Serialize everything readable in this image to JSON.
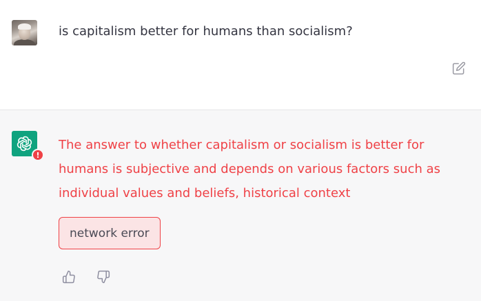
{
  "user_message": {
    "text": "is capitalism better for humans than socialism?"
  },
  "assistant_message": {
    "text": "The answer to whether capitalism or socialism is better for humans is subjective and depends on various factors such as individual values and beliefs, historical context",
    "error_badge": "!",
    "error_label": "network error"
  },
  "colors": {
    "error_red": "#ef4146",
    "brand_green": "#10a37f",
    "text_dark": "#343541",
    "assistant_bg": "#f7f7f8"
  },
  "icons": {
    "edit": "edit-icon",
    "thumbs_up": "thumbs-up-icon",
    "thumbs_down": "thumbs-down-icon",
    "assistant_logo": "openai-logo-icon"
  }
}
